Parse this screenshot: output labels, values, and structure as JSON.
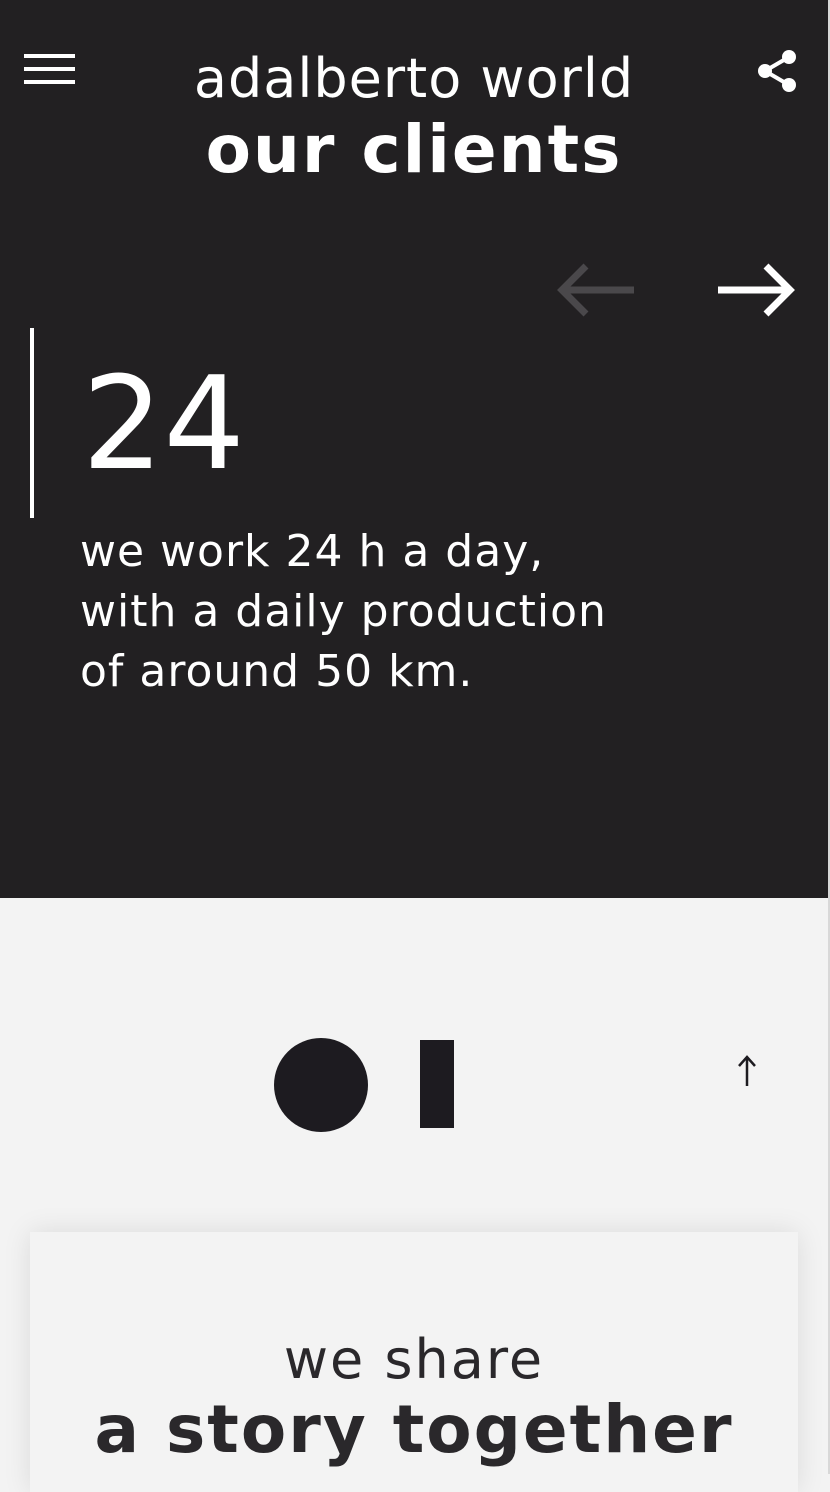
{
  "header": {
    "site_name": "adalberto world",
    "page_title": "our clients",
    "menu_icon": "hamburger-menu-icon",
    "share_icon": "share-icon"
  },
  "slider": {
    "prev_icon": "arrow-left-icon",
    "next_icon": "arrow-right-icon",
    "prev_enabled": false,
    "next_enabled": true,
    "stat": {
      "number": "24",
      "text": "we work 24 h a day, with a daily production of around 50 km."
    }
  },
  "footer_section": {
    "logo": "brand-logo",
    "scroll_top_icon": "arrow-up-icon",
    "story": {
      "line1": "we share",
      "line2": "a story together"
    }
  },
  "colors": {
    "hero_background": "#222022",
    "page_background": "#f3f3f3",
    "hero_text": "#ffffff",
    "dark_text": "#2a282b",
    "disabled_arrow": "#4a484b"
  }
}
